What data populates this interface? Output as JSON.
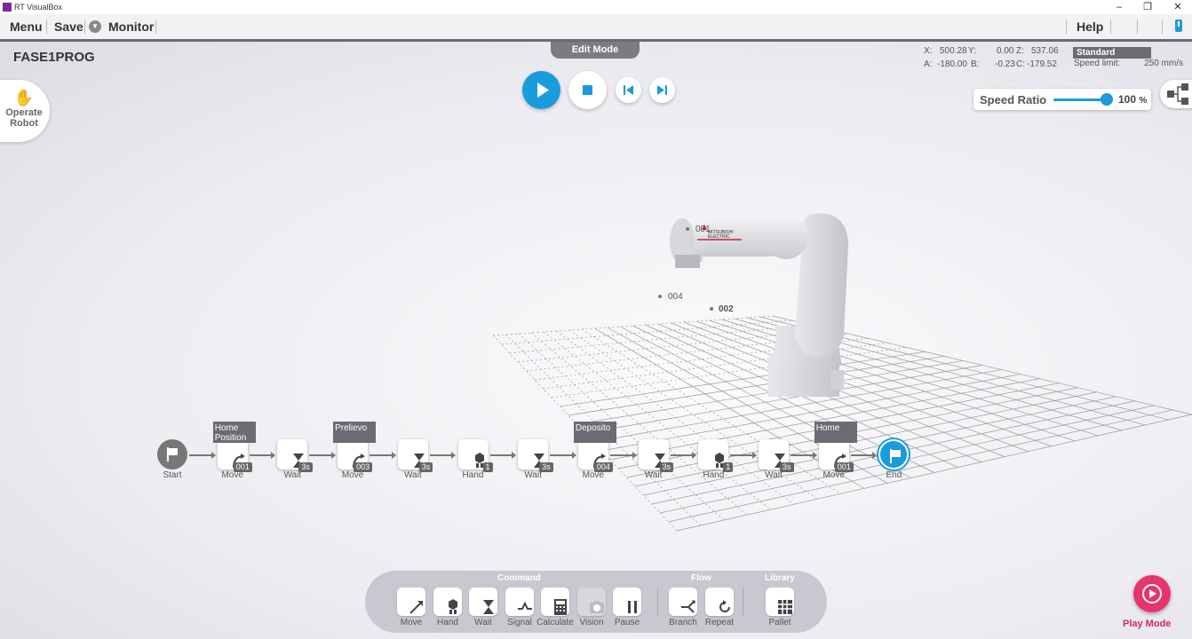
{
  "window": {
    "title": "RT VisualBox"
  },
  "menu": {
    "menu": "Menu",
    "save": "Save",
    "monitor": "Monitor",
    "help": "Help"
  },
  "mode_tab": "Edit Mode",
  "program_name": "FASE1PROG",
  "operate_robot": {
    "line1": "Operate",
    "line2": "Robot"
  },
  "coords": {
    "x_label": "X:",
    "x": "500.28",
    "y_label": "Y:",
    "y": "0.00",
    "z_label": "Z:",
    "z": "537.06",
    "a_label": "A:",
    "a": "-180.00",
    "b_label": "B:",
    "b": "-0.23",
    "c_label": "C:",
    "c": "-179.52"
  },
  "standard": "Standard",
  "speed_limit": {
    "label": "Speed limit:",
    "value": "250",
    "unit": "mm/s"
  },
  "speed_ratio": {
    "label": "Speed Ratio",
    "value": "100",
    "unit": "%",
    "level": 1.0
  },
  "points": [
    {
      "name": "001"
    },
    {
      "name": "004"
    },
    {
      "name": "002"
    }
  ],
  "flow": [
    {
      "kind": "start",
      "label": "Start"
    },
    {
      "kind": "move",
      "label": "Move",
      "badge": "001",
      "tag": "Home Position"
    },
    {
      "kind": "wait",
      "label": "Wait",
      "badge": "3s"
    },
    {
      "kind": "move",
      "label": "Move",
      "badge": "003",
      "tag": "Prelievo"
    },
    {
      "kind": "wait",
      "label": "Wait",
      "badge": "3s"
    },
    {
      "kind": "hand",
      "label": "Hand",
      "badge": "1"
    },
    {
      "kind": "wait",
      "label": "Wait",
      "badge": "3s"
    },
    {
      "kind": "move",
      "label": "Move",
      "badge": "004",
      "tag": "Deposito"
    },
    {
      "kind": "wait",
      "label": "Wait",
      "badge": "3s"
    },
    {
      "kind": "hand",
      "label": "Hand",
      "badge": "1"
    },
    {
      "kind": "wait",
      "label": "Wait",
      "badge": "3s"
    },
    {
      "kind": "move",
      "label": "Move",
      "badge": "001",
      "tag": "Home"
    },
    {
      "kind": "end",
      "label": "End"
    }
  ],
  "command_panel": {
    "command_head": "Command",
    "flow_head": "Flow",
    "library_head": "Library",
    "buttons": [
      {
        "label": "Move",
        "icon": "move-icon"
      },
      {
        "label": "Hand",
        "icon": "hand-icon"
      },
      {
        "label": "Wait",
        "icon": "hourglass-icon"
      },
      {
        "label": "Signal",
        "icon": "signal-icon"
      },
      {
        "label": "Calculate",
        "icon": "calculator-icon"
      },
      {
        "label": "Vision",
        "icon": "camera-icon"
      },
      {
        "label": "Pause",
        "icon": "pause-icon"
      },
      {
        "label": "Branch",
        "icon": "branch-icon"
      },
      {
        "label": "Repeat",
        "icon": "repeat-icon"
      },
      {
        "label": "Pallet",
        "icon": "grid-icon"
      }
    ]
  },
  "play_mode": "Play Mode",
  "colors": {
    "accent": "#1a9bdc",
    "play_mode": "#e8336b",
    "tag": "#6b6b73"
  }
}
